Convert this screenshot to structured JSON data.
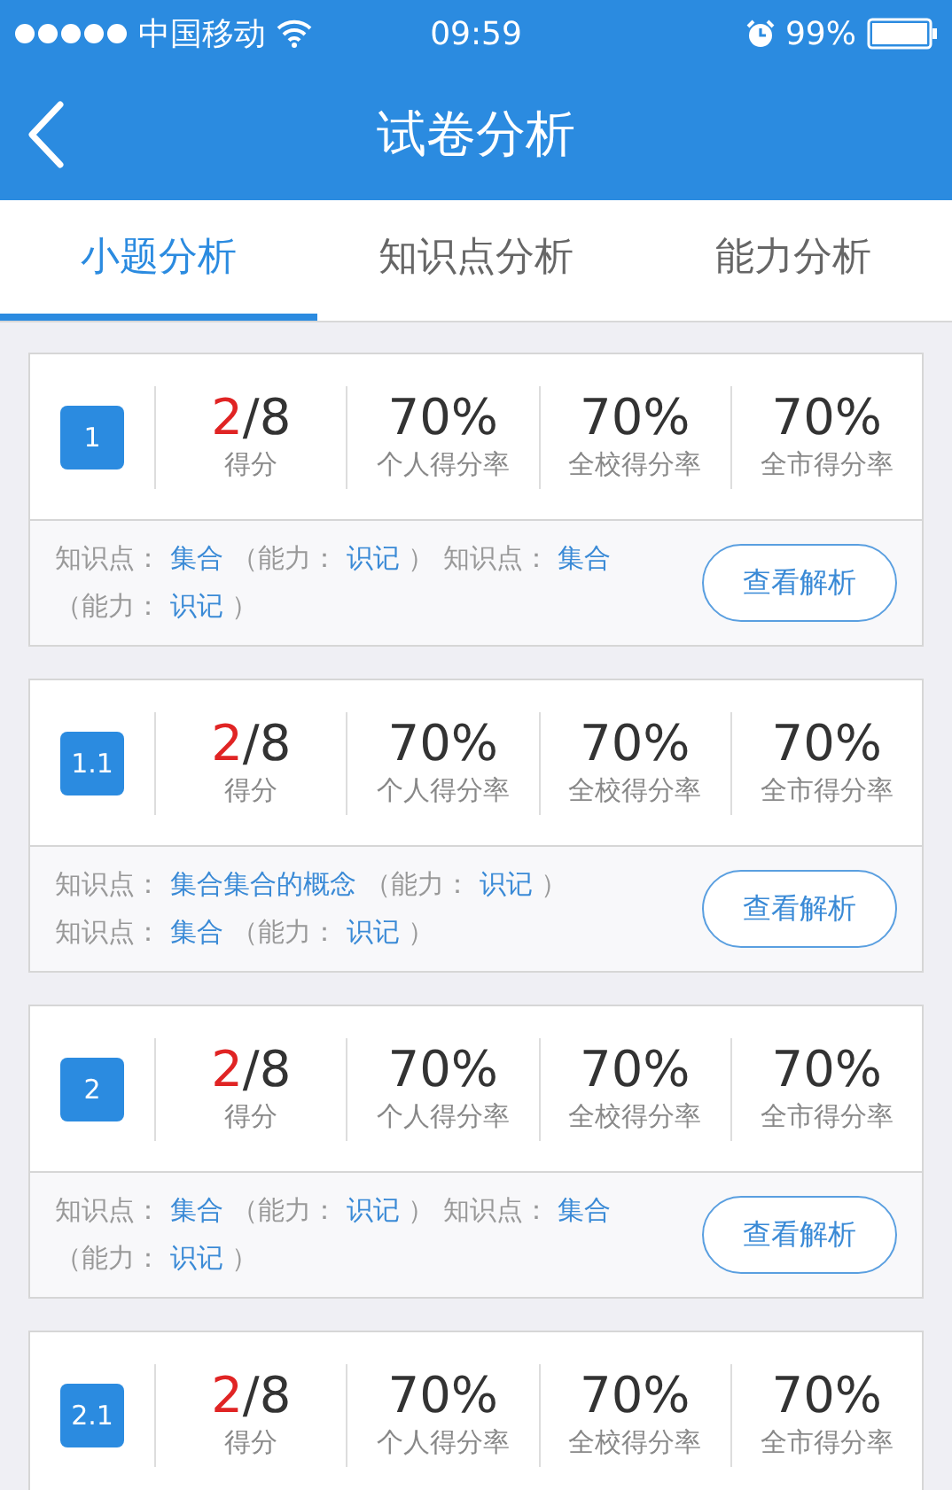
{
  "status_bar": {
    "carrier": "中国移动",
    "time": "09:59",
    "battery": "99%"
  },
  "nav": {
    "title": "试卷分析"
  },
  "tabs": [
    {
      "label": "小题分析",
      "selected": true
    },
    {
      "label": "知识点分析",
      "selected": false
    },
    {
      "label": "能力分析",
      "selected": false
    }
  ],
  "cards": [
    {
      "number": "1",
      "score": "2",
      "total": "/8",
      "score_label": "得分",
      "stats": [
        {
          "value": "70%",
          "label": "个人得分率"
        },
        {
          "value": "70%",
          "label": "全校得分率"
        },
        {
          "value": "70%",
          "label": "全市得分率"
        }
      ],
      "tags": [
        {
          "kind": "label",
          "text": "知识点："
        },
        {
          "kind": "value",
          "text": "集合"
        },
        {
          "kind": "label",
          "text": "（能力："
        },
        {
          "kind": "value",
          "text": "识记"
        },
        {
          "kind": "label",
          "text": "）"
        },
        {
          "kind": "label",
          "text": "知识点："
        },
        {
          "kind": "value",
          "text": "集合"
        },
        {
          "kind": "label",
          "text": "（能力："
        },
        {
          "kind": "value",
          "text": "识记"
        },
        {
          "kind": "label",
          "text": "）"
        }
      ],
      "button": "查看解析"
    },
    {
      "number": "1.1",
      "score": "2",
      "total": "/8",
      "score_label": "得分",
      "stats": [
        {
          "value": "70%",
          "label": "个人得分率"
        },
        {
          "value": "70%",
          "label": "全校得分率"
        },
        {
          "value": "70%",
          "label": "全市得分率"
        }
      ],
      "tags": [
        {
          "kind": "label",
          "text": "知识点："
        },
        {
          "kind": "value",
          "text": "集合集合的概念"
        },
        {
          "kind": "label",
          "text": "（能力："
        },
        {
          "kind": "value",
          "text": "识记"
        },
        {
          "kind": "label",
          "text": "）"
        },
        {
          "kind": "break"
        },
        {
          "kind": "label",
          "text": "知识点："
        },
        {
          "kind": "value",
          "text": "集合"
        },
        {
          "kind": "label",
          "text": "（能力："
        },
        {
          "kind": "value",
          "text": "识记"
        },
        {
          "kind": "label",
          "text": "）"
        }
      ],
      "button": "查看解析"
    },
    {
      "number": "2",
      "score": "2",
      "total": "/8",
      "score_label": "得分",
      "stats": [
        {
          "value": "70%",
          "label": "个人得分率"
        },
        {
          "value": "70%",
          "label": "全校得分率"
        },
        {
          "value": "70%",
          "label": "全市得分率"
        }
      ],
      "tags": [
        {
          "kind": "label",
          "text": "知识点："
        },
        {
          "kind": "value",
          "text": "集合"
        },
        {
          "kind": "label",
          "text": "（能力："
        },
        {
          "kind": "value",
          "text": "识记"
        },
        {
          "kind": "label",
          "text": "）"
        },
        {
          "kind": "label",
          "text": "知识点："
        },
        {
          "kind": "value",
          "text": "集合"
        },
        {
          "kind": "label",
          "text": "（能力："
        },
        {
          "kind": "value",
          "text": "识记"
        },
        {
          "kind": "label",
          "text": "）"
        }
      ],
      "button": "查看解析"
    },
    {
      "number": "2.1",
      "score": "2",
      "total": "/8",
      "score_label": "得分",
      "stats": [
        {
          "value": "70%",
          "label": "个人得分率"
        },
        {
          "value": "70%",
          "label": "全校得分率"
        },
        {
          "value": "70%",
          "label": "全市得分率"
        }
      ]
    }
  ]
}
